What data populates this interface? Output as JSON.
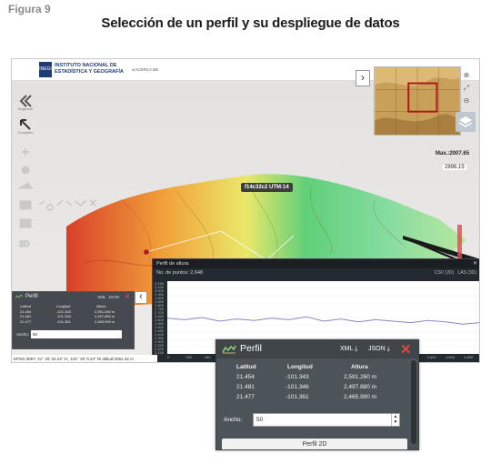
{
  "figure": {
    "label": "Figura 9",
    "title": "Selección de un perfil y su despliegue de datos"
  },
  "app": {
    "logo_mark": "INEGI",
    "org_name": "INSTITUTO NACIONAL DE ESTADÍSTICA Y GEOGRAFÍA",
    "about_link": "◂ ACERCA DE"
  },
  "left_tools": [
    {
      "icon": "back-arrows-icon",
      "label": "Regresar"
    },
    {
      "icon": "fullscreen-icon",
      "label": "Completo"
    }
  ],
  "map": {
    "tooltip": "f14c32c2 UTM:14",
    "max_label": "Max.:2007.65",
    "current_value": "2896.15"
  },
  "profile_window": {
    "title": "Perfil de altura",
    "points_label": "No. de puntos: 2,648",
    "exports": [
      "CSV (2D)",
      "LAS (3D)"
    ],
    "y_ticks": [
      "3,150",
      "3,100",
      "3,000",
      "2,950",
      "2,900",
      "2,850",
      "2,800",
      "2,750",
      "2,700",
      "2,650",
      "2,600",
      "2,550",
      "2,500",
      "2,450",
      "2,400",
      "2,350",
      "2,300",
      "2,250",
      "2,200",
      "2,150"
    ],
    "x_ticks": [
      "0",
      "200",
      "400",
      "600",
      "4,200",
      "4,400",
      "4,600",
      "4,800"
    ]
  },
  "chart_data": {
    "type": "line",
    "title": "Perfil de altura",
    "xlabel": "",
    "ylabel": "",
    "ylim": [
      2150,
      3150
    ],
    "series": [
      {
        "values": [
          2640,
          2620,
          2650,
          2600,
          2630,
          2610,
          2640,
          2620,
          2660,
          2600,
          2630,
          2590,
          2620,
          2600,
          2580,
          2610,
          2590,
          2560,
          2580
        ]
      }
    ]
  },
  "small_perfil": {
    "title": "Perfil",
    "xml": "XML",
    "json": "JSON",
    "columns": [
      "Latitud",
      "Longitud",
      "Altura"
    ],
    "rows": [
      [
        "21.454",
        "-101.343",
        "2,591.260 m"
      ],
      [
        "21.481",
        "-101.346",
        "2,497.880 m"
      ],
      [
        "21.477",
        "-101.361",
        "2,465.990 m"
      ]
    ],
    "ancho_label": "Ancho:",
    "ancho_value": "50"
  },
  "status_bar": "EPSG:3857: 21° 20' 33.24\" N , 101° 20' 9.24\" W altitud:2561.32 m",
  "big_perfil": {
    "title": "Perfil",
    "xml": "XML",
    "json": "JSON",
    "columns": [
      "Latitud",
      "Longitud",
      "Altura"
    ],
    "rows": [
      [
        "21.454",
        "-101.343",
        "2,591.260 m"
      ],
      [
        "21.481",
        "-101.346",
        "2,497.880 m"
      ],
      [
        "21.477",
        "-101.361",
        "2,465.990 m"
      ]
    ],
    "ancho_label": "Ancho:",
    "ancho_value": "50",
    "tab_label": "Perfil 2D"
  },
  "colors": {
    "accent_red": "#e2463e",
    "panel_dark": "#4d5459",
    "brand_blue": "#1f3c78"
  }
}
